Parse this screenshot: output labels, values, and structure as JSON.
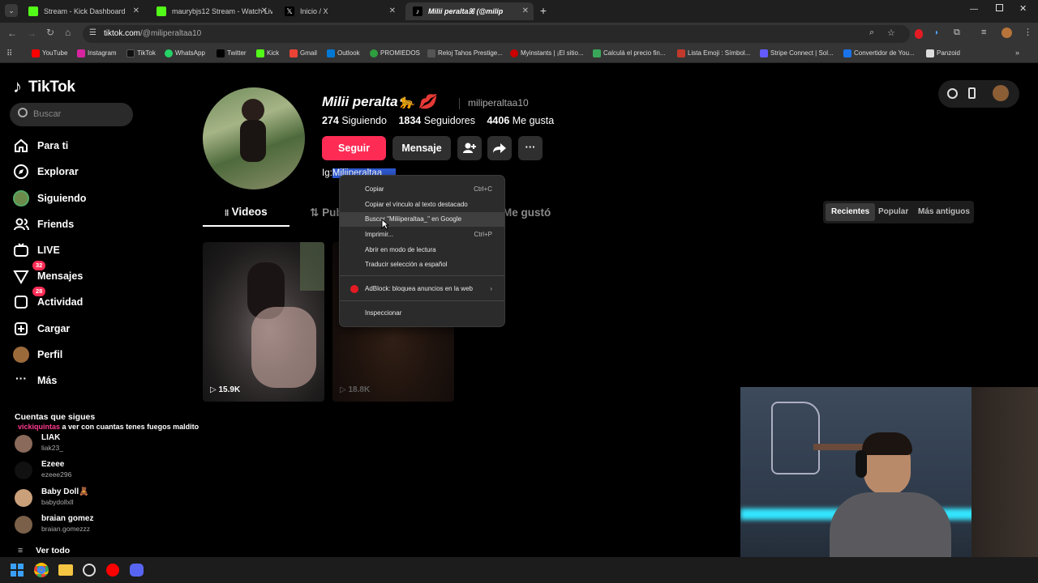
{
  "browser": {
    "tabs": [
      {
        "label": "Stream - Kick Dashboard",
        "active": false
      },
      {
        "label": "maurybjs12 Stream - Watch Live",
        "active": false
      },
      {
        "label": "Inicio / X",
        "active": false
      },
      {
        "label": "Milii peraltaꕤ (@milip",
        "active": true
      }
    ],
    "url_domain": "tiktok.com",
    "url_path": "/@miliperaltaa10",
    "bookmarks": [
      "YouTube",
      "Instagram",
      "TikTok",
      "WhatsApp",
      "Twitter",
      "Kick",
      "Gmail",
      "Outlook",
      "PROMIEDOS",
      "Reloj Tahos Prestige...",
      "Myinstants | ¡El sitio...",
      "Calculá el precio fin...",
      "Lista Emoji : Símbol...",
      "Stripe Connect | Sol...",
      "Convertidor de You...",
      "Panzoid"
    ]
  },
  "sidebar": {
    "logo": "TikTok",
    "search_placeholder": "Buscar",
    "nav": [
      {
        "label": "Para ti",
        "icon": "home-icon"
      },
      {
        "label": "Explorar",
        "icon": "compass-icon"
      },
      {
        "label": "Siguiendo",
        "icon": "following-avatar-icon"
      },
      {
        "label": "Friends",
        "icon": "friends-icon"
      },
      {
        "label": "LIVE",
        "icon": "live-icon"
      },
      {
        "label": "Mensajes",
        "icon": "messages-icon",
        "badge": "32"
      },
      {
        "label": "Actividad",
        "icon": "activity-icon",
        "badge": "28"
      },
      {
        "label": "Cargar",
        "icon": "upload-icon"
      },
      {
        "label": "Perfil",
        "icon": "profile-avatar-icon"
      },
      {
        "label": "Más",
        "icon": "more-icon"
      }
    ],
    "following_title": "Cuentas que sigues",
    "comment_user": "vickiquintas",
    "comment_text": "a ver con cuantas tenes fuegos maldito",
    "following": [
      {
        "name": "LIAK",
        "handle": "liak23_"
      },
      {
        "name": "Ezeee",
        "handle": "ezeee296"
      },
      {
        "name": "Baby Doll🧸",
        "handle": "babydollxll"
      },
      {
        "name": "braian gomez",
        "handle": "braian.gomezzz"
      }
    ],
    "see_all": "Ver todo"
  },
  "profile": {
    "display_name": "Milii peralta🐆 💋",
    "username": "miliperaltaa10",
    "following_count": "274",
    "following_label": "Siguiendo",
    "followers_count": "1834",
    "followers_label": "Seguidores",
    "likes_count": "4406",
    "likes_label": "Me gusta",
    "follow_button": "Seguir",
    "message_button": "Mensaje",
    "bio_prefix": "Ig:",
    "bio_selected": "Miliiperaltaa_",
    "tabs": [
      "Videos",
      "Publicaciones",
      "Me gustó"
    ],
    "sort": [
      "Recientes",
      "Popular",
      "Más antiguos"
    ],
    "videos": [
      {
        "views": "15.9K"
      },
      {
        "views": "18.8K"
      }
    ]
  },
  "context_menu": {
    "items": [
      {
        "label": "Copiar",
        "shortcut": "Ctrl+C"
      },
      {
        "label": "Copiar el vínculo al texto destacado",
        "shortcut": ""
      },
      {
        "label": "Buscar \"Miliiperaltaa_\" en Google",
        "shortcut": ""
      },
      {
        "label": "Imprimir...",
        "shortcut": "Ctrl+P"
      },
      {
        "label": "Abrir en modo de lectura",
        "shortcut": ""
      },
      {
        "label": "Traducir selección a español",
        "shortcut": ""
      },
      {
        "label": "AdBlock: bloquea anuncios en la web",
        "shortcut": ""
      },
      {
        "label": "Inspeccionar",
        "shortcut": ""
      }
    ]
  },
  "colors": {
    "accent": "#fe2c55",
    "selection": "#2f5bd6",
    "chrome_dark": "#1f1f1f",
    "chrome_mid": "#353535"
  }
}
